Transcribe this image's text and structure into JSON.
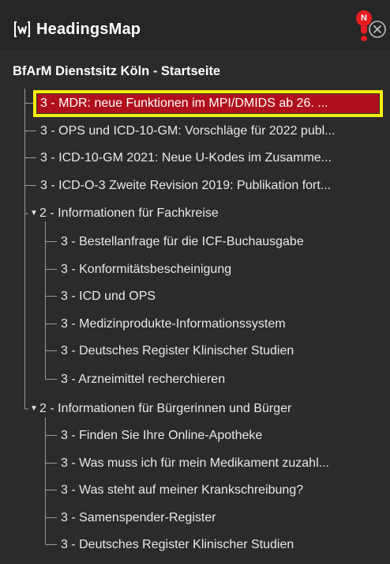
{
  "header": {
    "title": "HeadingsMap",
    "logo_icon": "headingsmap-logo-icon",
    "notification": {
      "badge": "N",
      "color": "#e81b21",
      "icon": "notification-icon"
    },
    "close_icon": "close-circle-icon"
  },
  "document_title": "BfArM Dienstsitz Köln - Startseite",
  "colors": {
    "panel_bg": "#2b2b2b",
    "header_bg": "#262626",
    "selected_bg": "#b0101c",
    "selected_outline": "#fbee0f",
    "text": "#e8e8e8"
  },
  "headings": {
    "h3_mdr": "3 - MDR: neue Funktionen im MPI/DMIDS ab 26. ...",
    "h3_ops_icd": "3 - OPS und ICD-10-GM: Vorschläge für 2022 publ...",
    "h3_icd_ukodes": "3 - ICD-10-GM 2021: Neue U-Kodes im Zusamme...",
    "h3_icdo3": "3 - ICD-O-3 Zweite Revision 2019: Publikation fort...",
    "h2_fachkreise": "2 - Informationen für Fachkreise",
    "h3_icf": "3 - Bestellanfrage für die ICF-Buchausgabe",
    "h3_konform": "3 - Konformitätsbescheinigung",
    "h3_icd_ops": "3 - ICD und OPS",
    "h3_mpis": "3 - Medizinprodukte-Informationssystem",
    "h3_drks_1": "3 - Deutsches Register Klinischer Studien",
    "h3_arznei": "3 - Arzneimittel recherchieren",
    "h2_buerger": "2 - Informationen für Bürgerinnen und Bürger",
    "h3_apotheke": "3 - Finden Sie Ihre Online-Apotheke",
    "h3_zuzahl": "3 - Was muss ich für mein Medikament zuzahl...",
    "h3_krank": "3 - Was steht auf meiner Krankschreibung?",
    "h3_samen": "3 - Samenspender-Register",
    "h3_drks_2": "3 - Deutsches Register Klinischer Studien"
  },
  "selected": "h3_mdr"
}
